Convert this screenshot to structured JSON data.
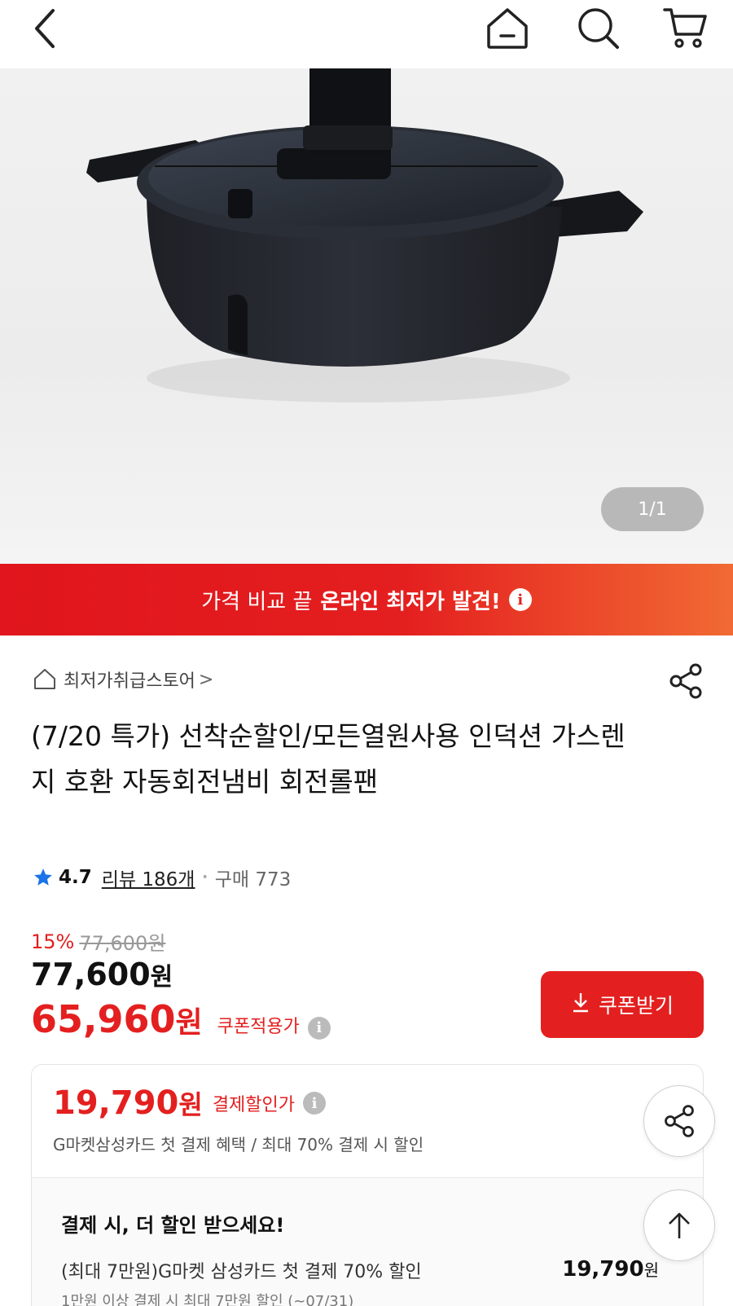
{
  "topbar": {
    "icons": [
      "back-icon",
      "home-icon",
      "search-icon",
      "cart-icon"
    ]
  },
  "gallery": {
    "counter": "1/1"
  },
  "promo": {
    "text": "가격 비교 끝",
    "highlight": "온라인 최저가 발견!",
    "info_glyph": "i"
  },
  "store": {
    "name": "최저가취급스토어",
    "chevron": ">"
  },
  "product": {
    "title": "(7/20 특가) 선착순할인/모든열원사용 인덕션 가스렌지 호환 자동회전냄비 회전롤팬",
    "rating": "4.7",
    "reviews": "리뷰 186개",
    "purchases": "구매 773"
  },
  "price": {
    "discount_rate": "15%",
    "original_strike": "77,600원",
    "original": "77,600",
    "final": "65,960",
    "won": "원",
    "coupon_label": "쿠폰적용가",
    "coupon_button": "쿠폰받기"
  },
  "payment": {
    "price": "19,790",
    "won": "원",
    "label": "결제할인가",
    "sub": "G마켓삼성카드 첫 결제 혜택 / 최대 70% 결제 시 할인",
    "heading": "결제 시, 더 할인 받으세요!",
    "line1": "(최대 7만원)G마켓 삼성카드 첫 결제 70% 할인",
    "line1_amount": "19,790",
    "line2": "1만원 이상 결제 시 최대 7만원 할인 (~07/31)"
  },
  "colors": {
    "accent": "#e41f1f",
    "accent_end": "#f16a34"
  }
}
